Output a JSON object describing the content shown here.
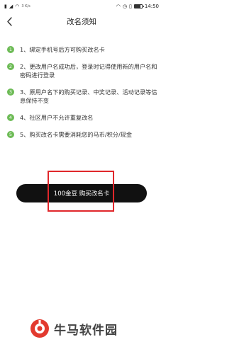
{
  "status_bar": {
    "speed": "3 K/s",
    "time": "14:50",
    "icons": [
      "sim-icon",
      "wifi-icon",
      "headphones-icon",
      "signal-icon",
      "alarm-icon",
      "battery-icon"
    ]
  },
  "header": {
    "title": "改名须知",
    "back_icon": "chevron-left-icon"
  },
  "rules": [
    {
      "num": "1",
      "text": "1、绑定手机号后方可购买改名卡"
    },
    {
      "num": "2",
      "text": "2、更改用户名成功后，登录时记得使用新的用户名和密码进行登录"
    },
    {
      "num": "3",
      "text": "3、原用户名下的购买记录、中奖记录、活动记录等信息保持不变"
    },
    {
      "num": "4",
      "text": "4、社区用户不允许重复改名"
    },
    {
      "num": "5",
      "text": "5、购买改名卡需要消耗您的马币/积分/现金"
    }
  ],
  "buy_button": {
    "label": "100金豆 购买改名卡"
  },
  "colors": {
    "accent_green": "#6dbb56",
    "button_black": "#111111",
    "highlight_red": "#e0272b"
  },
  "watermark": {
    "text": "牛马软件园"
  }
}
